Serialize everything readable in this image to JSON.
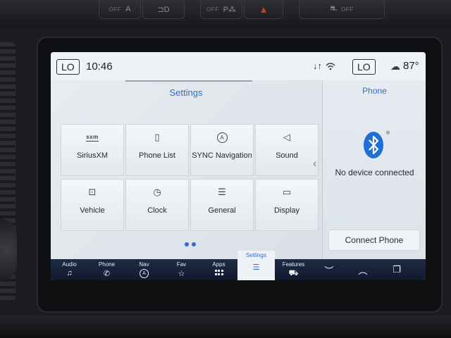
{
  "dash": {
    "buttons": [
      {
        "label": "OFF",
        "icon": "A",
        "icon_name": "auto-start-stop-icon"
      },
      {
        "label": "",
        "icon": "⊐D",
        "icon_name": "headlight-icon"
      },
      {
        "label": "OFF",
        "icon": "P⁂",
        "icon_name": "park-assist-icon"
      },
      {
        "label": "",
        "icon": "▲",
        "icon_name": "hazard-icon"
      },
      {
        "label": "OFF",
        "icon": "⛐",
        "icon_name": "traction-control-icon"
      }
    ]
  },
  "status_bar": {
    "driver_temp": "LO",
    "time": "10:46",
    "passenger_temp": "LO",
    "outside_temp": "87°"
  },
  "settings": {
    "title": "Settings",
    "tiles": [
      {
        "label": "SiriusXM",
        "icon": "sxm",
        "icon_name": "siriusxm-icon"
      },
      {
        "label": "Phone List",
        "icon": "▯",
        "icon_name": "phone-list-icon"
      },
      {
        "label": "SYNC Navigation",
        "icon": "A",
        "icon_name": "navigation-icon"
      },
      {
        "label": "Sound",
        "icon": "◁",
        "icon_name": "speaker-icon"
      },
      {
        "label": "Vehicle",
        "icon": "⊡",
        "icon_name": "vehicle-icon"
      },
      {
        "label": "Clock",
        "icon": "◷",
        "icon_name": "clock-icon"
      },
      {
        "label": "General",
        "icon": "☰",
        "icon_name": "sliders-icon"
      },
      {
        "label": "Display",
        "icon": "▭",
        "icon_name": "display-icon"
      }
    ],
    "page_count": 2
  },
  "phone_panel": {
    "title": "Phone",
    "status": "No device connected",
    "connect_label": "Connect Phone"
  },
  "nav": {
    "items": [
      {
        "label": "Audio",
        "icon": "♫",
        "icon_name": "music-note-icon"
      },
      {
        "label": "Phone",
        "icon": "✆",
        "icon_name": "phone-icon"
      },
      {
        "label": "Nav",
        "icon": "A",
        "icon_name": "navigation-icon"
      },
      {
        "label": "Fav",
        "icon": "☆",
        "icon_name": "star-icon"
      },
      {
        "label": "Apps",
        "icon": "",
        "icon_name": "apps-grid-icon"
      },
      {
        "label": "Settings",
        "icon": "☰",
        "icon_name": "settings-sliders-icon"
      },
      {
        "label": "Features",
        "icon": "⛟",
        "icon_name": "truck-icon"
      }
    ],
    "right_icons": [
      {
        "icon": "︶",
        "icon_name": "chevron-down-icon"
      },
      {
        "icon": "︵",
        "icon_name": "chevron-up-icon"
      },
      {
        "icon": "❐",
        "icon_name": "split-screen-icon"
      }
    ],
    "active": "Settings"
  },
  "colors": {
    "accent": "#2f6fc9",
    "bluetooth": "#1f6fd6",
    "nav_bg": "#1a2640"
  }
}
